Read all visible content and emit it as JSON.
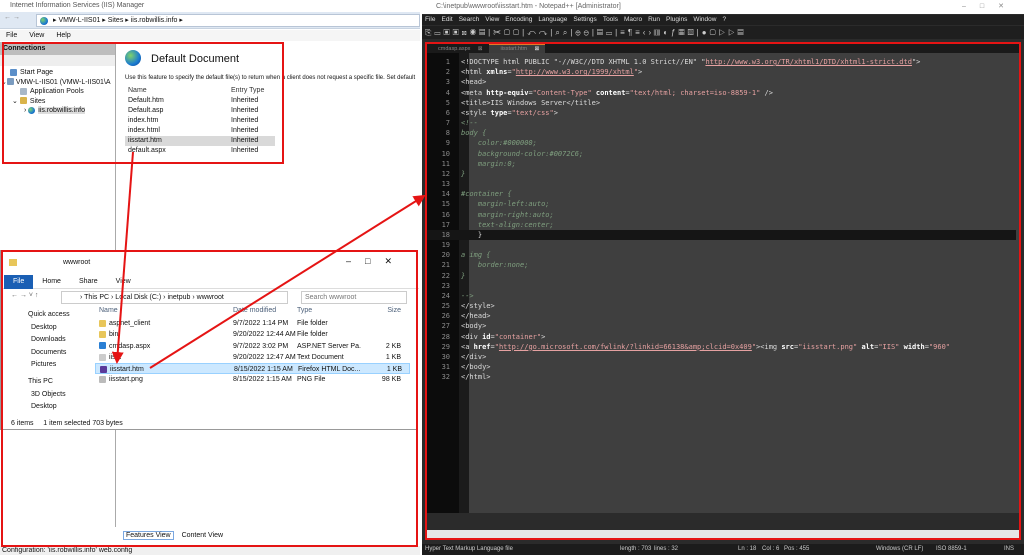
{
  "iis": {
    "title": "Internet Information Services (IIS) Manager",
    "breadcrumb": [
      "VMW-L-IIS01",
      "Sites",
      "iis.robwillis.info"
    ],
    "menu": [
      "File",
      "View",
      "Help"
    ],
    "connections_label": "Connections",
    "tree": [
      "Start Page",
      "VMW-L-IIS01 (VMW-L-IIS01\\A",
      "Application Pools",
      "Sites",
      "iis.robwillis.info"
    ],
    "feature_title": "Default Document",
    "description": "Use this feature to specify the default file(s) to return when a client does not request a specific file. Set default",
    "columns": [
      "Name",
      "Entry Type"
    ],
    "rows": [
      [
        "Default.htm",
        "Inherited"
      ],
      [
        "Default.asp",
        "Inherited"
      ],
      [
        "index.htm",
        "Inherited"
      ],
      [
        "index.html",
        "Inherited"
      ],
      [
        "iisstart.htm",
        "Inherited"
      ],
      [
        "default.aspx",
        "Inherited"
      ]
    ],
    "features_view": "Features View",
    "content_view": "Content View",
    "status": "Configuration: 'iis.robwillis.info' web.config"
  },
  "explorer": {
    "title": "wwwroot",
    "ribbon": [
      "File",
      "Home",
      "Share",
      "View"
    ],
    "path": [
      "This PC",
      "Local Disk (C:)",
      "inetpub",
      "wwwroot"
    ],
    "search_placeholder": "Search wwwroot",
    "nav": [
      "Quick access",
      "Desktop",
      "Downloads",
      "Documents",
      "Pictures",
      "This PC",
      "3D Objects",
      "Desktop"
    ],
    "columns": [
      "Name",
      "Date modified",
      "Type",
      "Size"
    ],
    "files": [
      [
        "aspnet_client",
        "9/7/2022 1:14 PM",
        "File folder",
        ""
      ],
      [
        "bin",
        "9/20/2022 12:44 AM",
        "File folder",
        ""
      ],
      [
        "cmdasp.aspx",
        "9/7/2022 3:02 PM",
        "ASP.NET Server Pa...",
        "2 KB"
      ],
      [
        "iisst",
        "9/20/2022 12:47 AM",
        "Text Document",
        "1 KB"
      ],
      [
        "iisstart.htm",
        "8/15/2022 1:15 AM",
        "Firefox HTML Doc...",
        "1 KB"
      ],
      [
        "iisstart.png",
        "8/15/2022 1:15 AM",
        "PNG File",
        "98 KB"
      ]
    ],
    "status": {
      "items": "6 items",
      "selected": "1 item selected",
      "size": "703 bytes"
    }
  },
  "npp": {
    "title": "C:\\inetpub\\wwwroot\\iisstart.htm - Notepad++ [Administrator]",
    "menu": [
      "File",
      "Edit",
      "Search",
      "View",
      "Encoding",
      "Language",
      "Settings",
      "Tools",
      "Macro",
      "Run",
      "Plugins",
      "Window",
      "?"
    ],
    "tabs": [
      "cmdasp.aspx",
      "iisstart.htm"
    ],
    "current_line": 18,
    "code": [
      [
        [
          "tag",
          "<!DOCTYPE html PUBLIC \"-//W3C//DTD XHTML 1.0 Strict//EN\" \""
        ],
        [
          "url",
          "http://www.w3.org/TR/xhtml1/DTD/xhtml1-strict.dtd"
        ],
        [
          "tag",
          "\">"
        ]
      ],
      [
        [
          "tag",
          "<html "
        ],
        [
          "attr",
          "xmlns"
        ],
        [
          "tag",
          "="
        ],
        [
          "str",
          "\""
        ],
        [
          "url",
          "http://www.w3.org/1999/xhtml"
        ],
        [
          "str",
          "\""
        ],
        [
          "tag",
          ">"
        ]
      ],
      [
        [
          "tag",
          "<head>"
        ]
      ],
      [
        [
          "tag",
          "<meta "
        ],
        [
          "attr",
          "http-equiv"
        ],
        [
          "tag",
          "="
        ],
        [
          "str",
          "\"Content-Type\""
        ],
        [
          "tag",
          " "
        ],
        [
          "attr",
          "content"
        ],
        [
          "tag",
          "="
        ],
        [
          "str",
          "\"text/html; charset=iso-8859-1\""
        ],
        [
          "tag",
          " />"
        ]
      ],
      [
        [
          "tag",
          "<title>IIS Windows Server</title>"
        ]
      ],
      [
        [
          "tag",
          "<style "
        ],
        [
          "attr",
          "type"
        ],
        [
          "tag",
          "="
        ],
        [
          "str",
          "\"text/css\""
        ],
        [
          "tag",
          ">"
        ]
      ],
      [
        [
          "cmt",
          "<!--"
        ]
      ],
      [
        [
          "cmt",
          "body {"
        ]
      ],
      [
        [
          "cmt",
          "    color:#000000;"
        ]
      ],
      [
        [
          "cmt",
          "    background-color:#0072C6;"
        ]
      ],
      [
        [
          "cmt",
          "    margin:0;"
        ]
      ],
      [
        [
          "cmt",
          "}"
        ]
      ],
      [
        [
          "cmt",
          ""
        ]
      ],
      [
        [
          "cmt",
          "#container {"
        ]
      ],
      [
        [
          "cmt",
          "    margin-left:auto;"
        ]
      ],
      [
        [
          "cmt",
          "    margin-right:auto;"
        ]
      ],
      [
        [
          "cmt",
          "    text-align:center;"
        ]
      ],
      [
        [
          "tag",
          "    }"
        ]
      ],
      [
        [
          "cmt",
          ""
        ]
      ],
      [
        [
          "cmt",
          "a img {"
        ]
      ],
      [
        [
          "cmt",
          "    border:none;"
        ]
      ],
      [
        [
          "cmt",
          "}"
        ]
      ],
      [
        [
          "cmt",
          ""
        ]
      ],
      [
        [
          "cmt",
          "-->"
        ]
      ],
      [
        [
          "tag",
          "</style>"
        ]
      ],
      [
        [
          "tag",
          "</head>"
        ]
      ],
      [
        [
          "tag",
          "<body>"
        ]
      ],
      [
        [
          "tag",
          "<div "
        ],
        [
          "attr",
          "id"
        ],
        [
          "tag",
          "="
        ],
        [
          "str",
          "\"container\""
        ],
        [
          "tag",
          ">"
        ]
      ],
      [
        [
          "tag",
          "<a "
        ],
        [
          "attr",
          "href"
        ],
        [
          "tag",
          "="
        ],
        [
          "str",
          "\""
        ],
        [
          "url",
          "http://go.microsoft.com/fwlink/?linkid=66138&amp;clcid=0x409"
        ],
        [
          "str",
          "\""
        ],
        [
          "tag",
          "><img "
        ],
        [
          "attr",
          "src"
        ],
        [
          "tag",
          "="
        ],
        [
          "str",
          "\"iisstart.png\""
        ],
        [
          "tag",
          " "
        ],
        [
          "attr",
          "alt"
        ],
        [
          "tag",
          "="
        ],
        [
          "str",
          "\"IIS\""
        ],
        [
          "tag",
          " "
        ],
        [
          "attr",
          "width"
        ],
        [
          "tag",
          "="
        ],
        [
          "str",
          "\"960\""
        ]
      ],
      [
        [
          "tag",
          "</div>"
        ]
      ],
      [
        [
          "tag",
          "</body>"
        ]
      ],
      [
        [
          "tag",
          "</html>"
        ]
      ]
    ],
    "status": {
      "filetype": "Hyper Text Markup Language file",
      "length": "length : 703",
      "lines": "lines : 32",
      "ln": "Ln : 18",
      "col": "Col : 6",
      "pos": "Pos : 455",
      "eol": "Windows (CR LF)",
      "enc": "ISO 8859-1",
      "mode": "INS"
    }
  },
  "colors": {
    "annotation": "#e51414",
    "npp_bg": "#3f3f3f",
    "explorer_accent": "#1a5fb4"
  }
}
